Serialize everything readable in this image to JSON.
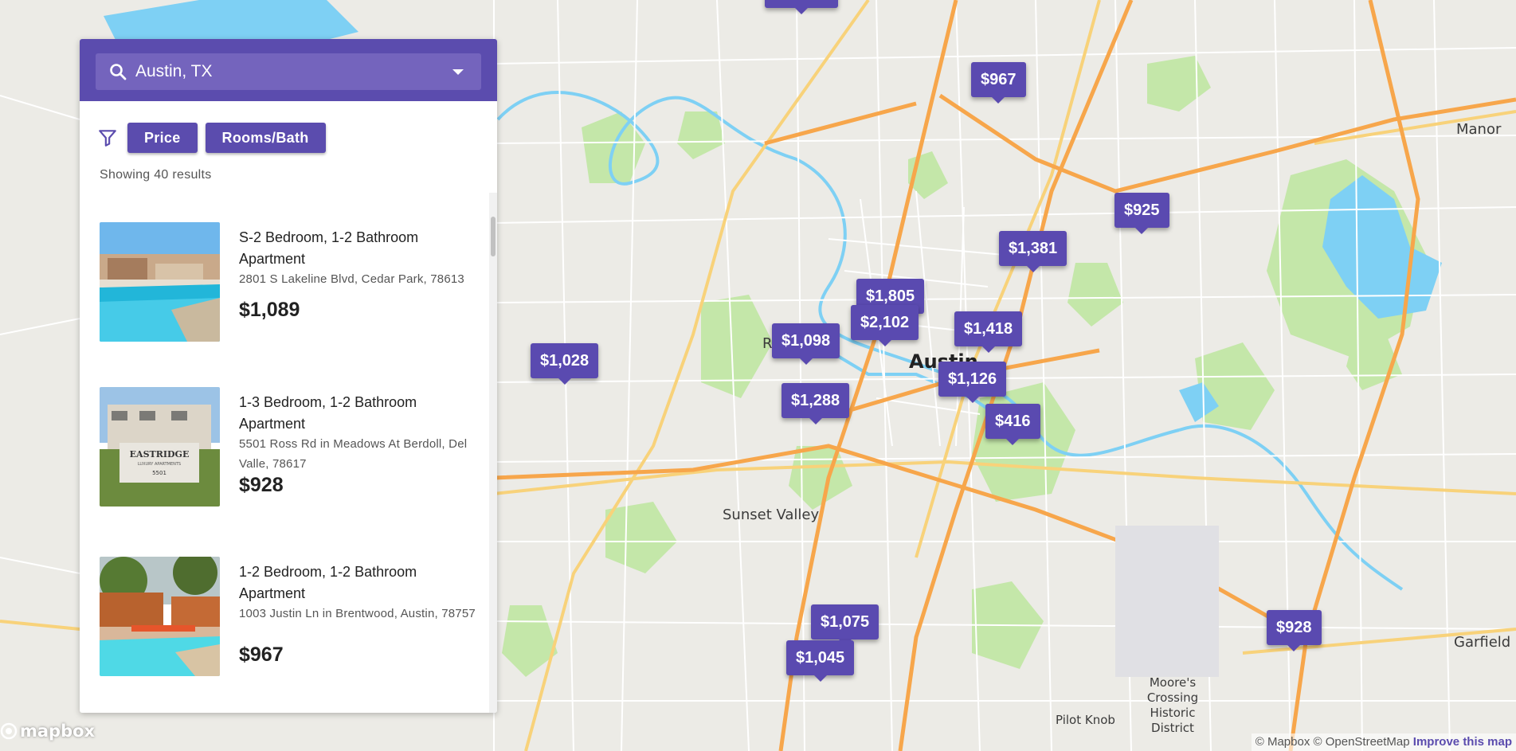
{
  "search": {
    "value": "Austin, TX"
  },
  "filters": {
    "price_label": "Price",
    "rooms_label": "Rooms/Bath"
  },
  "results_text": "Showing 40 results",
  "listings": [
    {
      "title": "S-2 Bedroom, 1-2 Bathroom Apartment",
      "address": "2801 S Lakeline Blvd, Cedar Park, 78613",
      "price": "$1,089"
    },
    {
      "title": "1-3 Bedroom, 1-2 Bathroom Apartment",
      "address": "5501 Ross Rd in Meadows At Berdoll, Del Valle, 78617",
      "price": "$928",
      "sign_text": "EASTRIDGE",
      "sign_sub": "LUXURY APARTMENTS",
      "sign_num": "5501"
    },
    {
      "title": "1-2 Bedroom, 1-2 Bathroom Apartment",
      "address": "1003 Justin Ln in Brentwood, Austin, 78757",
      "price": "$967"
    }
  ],
  "map": {
    "labels": {
      "austin": "Austin",
      "sunset_valley": "Sunset Valley",
      "manor": "Manor",
      "garfield": "Garfield",
      "pilot_knob": "Pilot Knob",
      "moores_crossing": "Moore's Crossing Historic District",
      "r_fragment": "R"
    },
    "markers": [
      {
        "price": "$967"
      },
      {
        "price": "$925"
      },
      {
        "price": "$1,381"
      },
      {
        "price": "$1,805"
      },
      {
        "price": "$2,102"
      },
      {
        "price": "$1,418"
      },
      {
        "price": "$1,098"
      },
      {
        "price": "$1,028"
      },
      {
        "price": "$1,126"
      },
      {
        "price": "$1,288"
      },
      {
        "price": "$416"
      },
      {
        "price": "$1,075"
      },
      {
        "price": "$1,045"
      },
      {
        "price": "$928"
      }
    ],
    "attribution": {
      "mapbox": "© Mapbox",
      "osm": "© OpenStreetMap",
      "improve": "Improve this map"
    },
    "logo": "mapbox",
    "colors": {
      "water": "#7ed0f4",
      "park": "#c4e7a9",
      "highway": "#f7a64b",
      "arterial": "#f8d27a",
      "accent": "#5b4cae"
    }
  }
}
